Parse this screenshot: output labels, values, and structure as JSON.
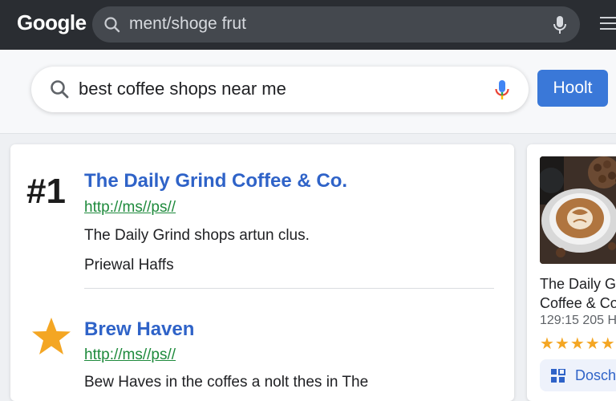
{
  "browser": {
    "logo": "Google",
    "url_text": "ment/shoge frut"
  },
  "search": {
    "query": "best coffee shops near me",
    "button_label": "Hoolt"
  },
  "results": [
    {
      "rank": "#1",
      "title": "The Daily Grind Coffee & Co.",
      "url": "http://ms//ps//",
      "description": "The Daily Grind shops artun clus.",
      "extra": "Priewal Haffs"
    },
    {
      "rank_icon": "star-icon",
      "title": "Brew Haven",
      "url": "http://ms//ps//",
      "description": "Bew Haves in the coffes a nolt thes in The"
    }
  ],
  "knowledge_panel": {
    "name_line1": "The Daily G",
    "name_line2": "Coffee & Co",
    "meta": "129:15 205 H",
    "stars": "★★★★★",
    "rating": 4.5,
    "button_label": "Dosch",
    "image": "coffee-latte-art-photo"
  },
  "colors": {
    "topbar": "#2a2d32",
    "accent_blue": "#3a78d8",
    "link_title": "#2f63c8",
    "url_green": "#1e8a3c",
    "star_gold": "#f4a623"
  }
}
